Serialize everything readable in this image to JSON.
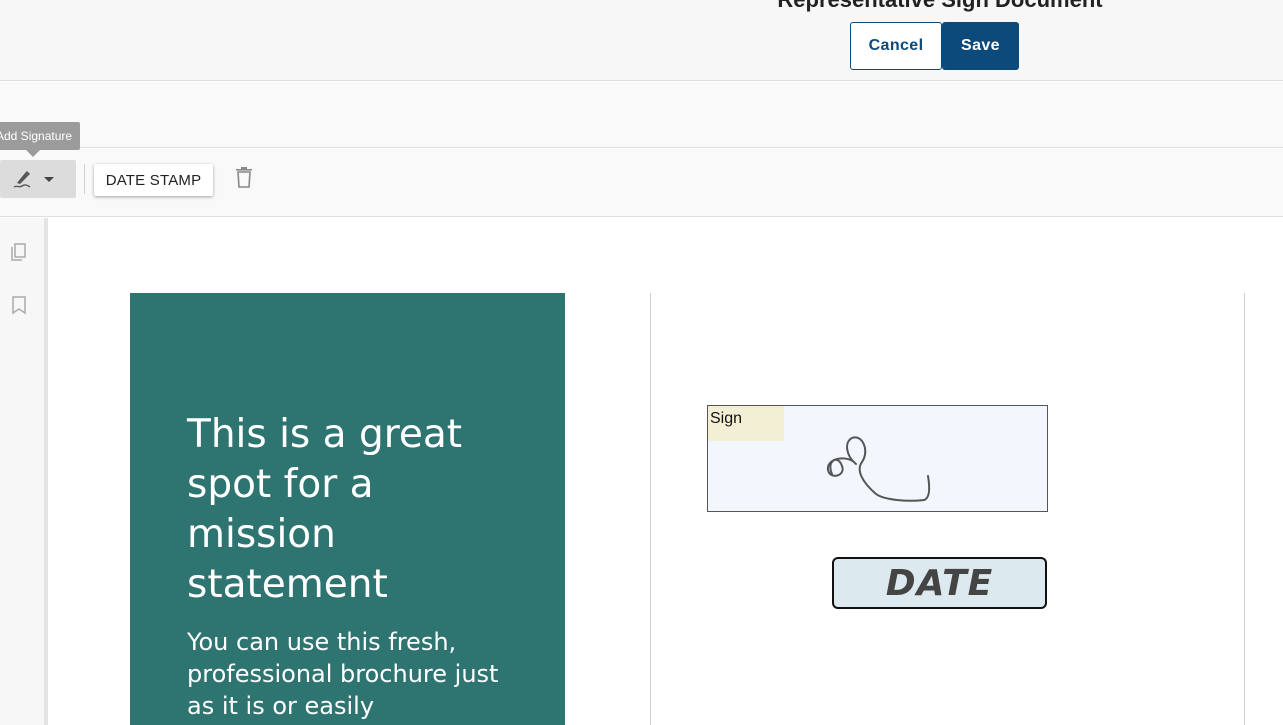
{
  "header": {
    "title": "Representative Sign Document",
    "cancel_label": "Cancel",
    "save_label": "Save",
    "accent_color": "#0b4a7a"
  },
  "toolbar": {
    "tooltip": "Add Signature",
    "signature_icon": "signature-pen-icon",
    "date_stamp_label": "DATE STAMP",
    "delete_icon": "trash-icon"
  },
  "sidenav": {
    "icons": [
      "pages-icon",
      "bookmark-icon"
    ]
  },
  "document": {
    "panel_color": "#2e7471",
    "mission_heading": "This is a great spot for a mission statement",
    "mission_body": "You can use this fresh, professional brochure just as it is or easily",
    "sign_field_label": "Sign",
    "date_field_label": "DATE"
  }
}
